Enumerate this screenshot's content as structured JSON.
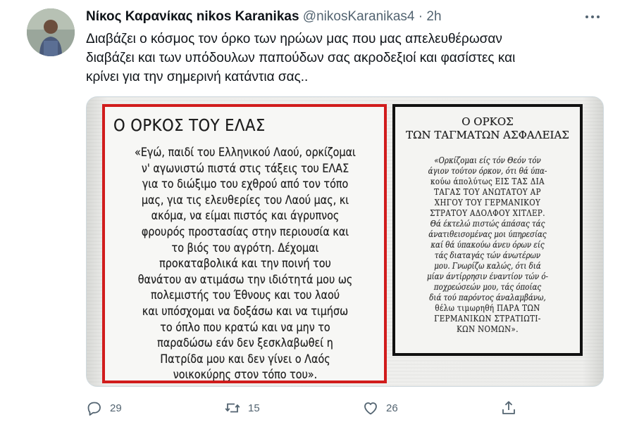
{
  "author": {
    "name": "Νίκος Καρανίκας nikos Karanikas",
    "handle": "@nikosKaranikas4",
    "separator": "·",
    "time": "2h"
  },
  "tweet": {
    "lines": [
      "Διαβάζει ο κόσμος τον  όρκο των ηρώων μας που μας απελευθέρωσαν",
      "διαβάζει και των υπόδουλων παπούδων σας ακροδεξιοί και φασίστες και",
      "κρίνει για την σημερινή κατάντια σας.."
    ]
  },
  "media": {
    "left": {
      "title": "Ο ΟΡΚΟΣ ΤΟΥ ΕΛΑΣ",
      "lines": [
        "«Εγώ, παιδί του Ελληνικού Λαού, ορκίζομαι",
        "ν' αγωνιστώ πιστά στις τάξεις του ΕΛΑΣ",
        "για το διώξιμο του εχθρού από τον τόπο",
        "μας, για τις ελευθερίες του Λαού μας, κι",
        "ακόμα, να είμαι πιστός και άγρυπνος",
        "φρουρός προστασίας στην περιουσία και",
        "το βιός του αγρότη. Δέχομαι",
        "προκαταβολικά και την ποινή του",
        "θανάτου αν ατιμάσω την ιδιότητά μου ως",
        "πολεμιστής του Έθνους και του λαού",
        "και υπόσχομαι να δοξάσω και να τιμήσω",
        "το όπλο που κρατώ και να μην το",
        "παραδώσω εάν δεν ξεσκλαβωθεί η",
        "Πατρίδα μου και δεν γίνει ο Λαός",
        "νοικοκύρης στον τόπο του»."
      ]
    },
    "right": {
      "title_1": "Ο ΟΡΚΟΣ",
      "title_2": "ΤΩΝ ΤΑΓΜΑΤΩΝ ΑΣΦΑΛΕΙΑΣ",
      "lines": [
        "«Ορκίζομαι είς τόν Θεόν τόν",
        "άγιον τούτον όρκον, ότι θά ύπα-",
        "κούω άπολύτως ΕΙΣ ΤΑΣ ΔΙΑ",
        "ΤΑΓΑΣ ΤΟΥ ΑΝΩΤΑΤΟΥ ΑΡ",
        "ΧΗΓΟΥ ΤΟΥ ΓΕΡΜΑΝΙΚΟΥ",
        "ΣΤΡΑΤΟΥ ΑΔΟΛΦΟΥ ΧΙΤΛΕΡ.",
        "Θά έκτελώ πιστώς άπάσας τάς",
        "άνατιθεισομένας μοι ύπηρεσίας",
        "καί θά ύπακούω άνευ όρων είς",
        "τάς διαταγάς τών άνωτέρων",
        "μου. Γνωρίζω καλώς, ότι διά",
        "μίαν άντίρρησιν έναντίον τών ό-",
        "ποχρεώσεών μου, τάς όποίας",
        "διά τού παρόντος άναλαμβάνω,",
        "θέλω τιμωρηθή ΠΑΡΑ ΤΩΝ",
        "ΓΕΡΜΑΝΙΚΩΝ ΣΤΡΑΤΙΩΤΙ-",
        "ΚΩΝ ΝΟΜΩΝ»."
      ]
    }
  },
  "actions": {
    "reply_count": "29",
    "retweet_count": "15",
    "like_count": "26"
  }
}
